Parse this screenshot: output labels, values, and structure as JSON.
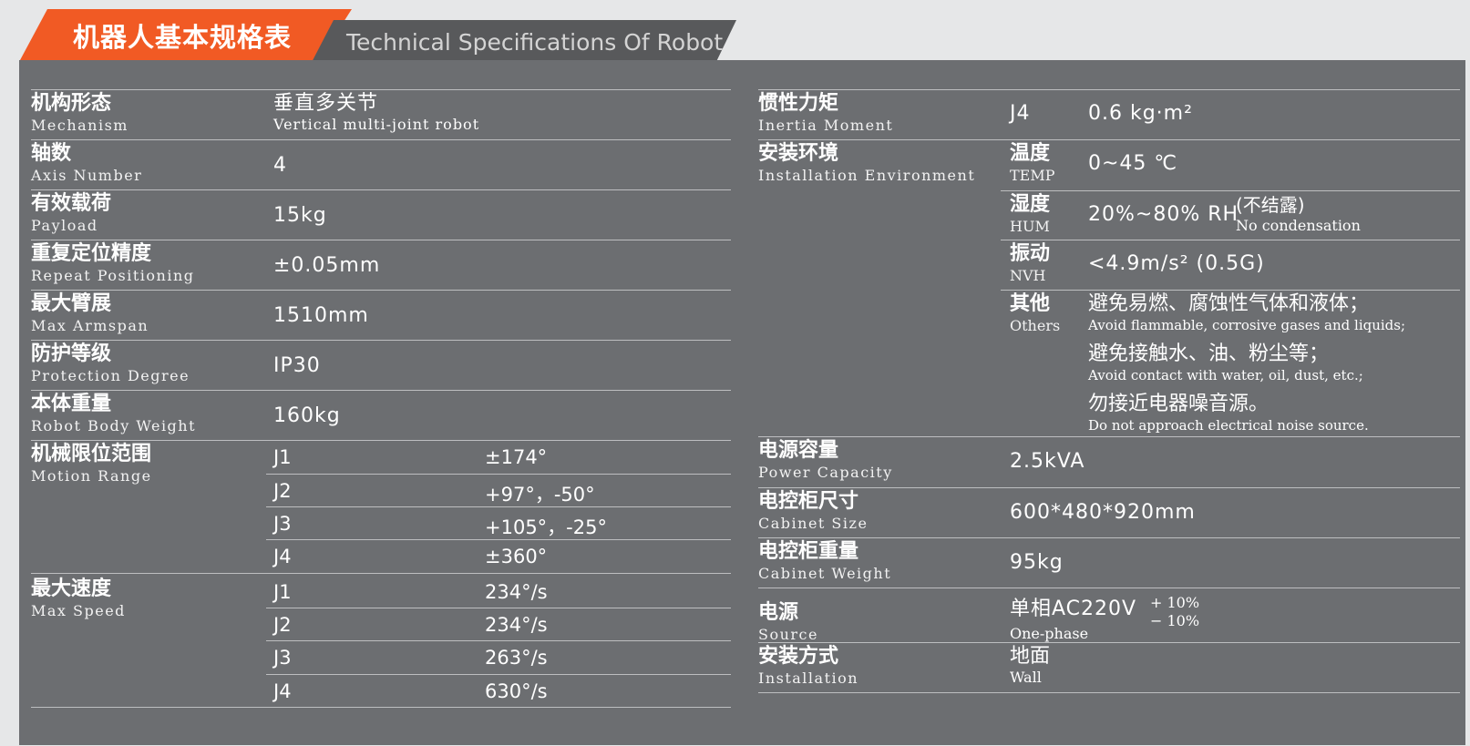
{
  "header": {
    "title_cn": "机器人基本规格表",
    "title_en": "Technical Specifications Of Robot"
  },
  "left": {
    "mechanism": {
      "cn": "机构形态",
      "en": "Mechanism",
      "value_cn": "垂直多关节",
      "value_en": "Vertical multi-joint robot"
    },
    "axis": {
      "cn": "轴数",
      "en": "Axis Number",
      "value": "4"
    },
    "payload": {
      "cn": "有效载荷",
      "en": "Payload",
      "value": "15kg"
    },
    "repeat": {
      "cn": "重复定位精度",
      "en": "Repeat Positioning",
      "value": "±0.05mm"
    },
    "armspan": {
      "cn": "最大臂展",
      "en": "Max Armspan",
      "value": "1510mm"
    },
    "protection": {
      "cn": "防护等级",
      "en": "Protection Degree",
      "value": "IP30"
    },
    "weight": {
      "cn": "本体重量",
      "en": "Robot Body Weight",
      "value": "160kg"
    },
    "motion": {
      "cn": "机械限位范围",
      "en": "Motion Range",
      "joints": [
        {
          "j": "J1",
          "v": "±174°"
        },
        {
          "j": "J2",
          "v": "+97°，-50°"
        },
        {
          "j": "J3",
          "v": "+105°，-25°"
        },
        {
          "j": "J4",
          "v": "±360°"
        }
      ]
    },
    "speed": {
      "cn": "最大速度",
      "en": "Max Speed",
      "joints": [
        {
          "j": "J1",
          "v": "234°/s"
        },
        {
          "j": "J2",
          "v": "234°/s"
        },
        {
          "j": "J3",
          "v": "263°/s"
        },
        {
          "j": "J4",
          "v": "630°/s"
        }
      ]
    }
  },
  "right": {
    "inertia": {
      "cn": "惯性力矩",
      "en": "Inertia Moment",
      "joint": "J4",
      "value": "0.6 kg·m²"
    },
    "env": {
      "cn": "安装环境",
      "en": "Installation Environment",
      "temp": {
        "cn": "温度",
        "en": "TEMP",
        "value": "0~45 ℃"
      },
      "hum": {
        "cn": "湿度",
        "en": "HUM",
        "value": "20%~80% RH",
        "note_cn": "(不结露)",
        "note_en": "No condensation"
      },
      "nvh": {
        "cn": "振动",
        "en": "NVH",
        "value": "<4.9m/s² (0.5G)"
      },
      "others": {
        "cn": "其他",
        "en": "Others",
        "items": [
          {
            "cn": "避免易燃、腐蚀性气体和液体；",
            "en": "Avoid flammable, corrosive gases and liquids;"
          },
          {
            "cn": "避免接触水、油、粉尘等；",
            "en": "Avoid contact with water, oil, dust, etc.;"
          },
          {
            "cn": "勿接近电器噪音源。",
            "en": "Do not approach electrical noise source."
          }
        ]
      }
    },
    "power": {
      "cn": "电源容量",
      "en": "Power Capacity",
      "value": "2.5kVA"
    },
    "cabinet_size": {
      "cn": "电控柜尺寸",
      "en": "Cabinet Size",
      "value": "600*480*920mm"
    },
    "cabinet_weight": {
      "cn": "电控柜重量",
      "en": "Cabinet Weight",
      "value": "95kg"
    },
    "source": {
      "cn": "电源",
      "en": "Source",
      "value": "单相AC220V",
      "tol_plus": "+ 10%",
      "tol_minus": "− 10%",
      "value_en": "One-phase"
    },
    "installation": {
      "cn": "安装方式",
      "en": "Installation",
      "value_cn": "地面",
      "value_en": "Wall"
    }
  }
}
